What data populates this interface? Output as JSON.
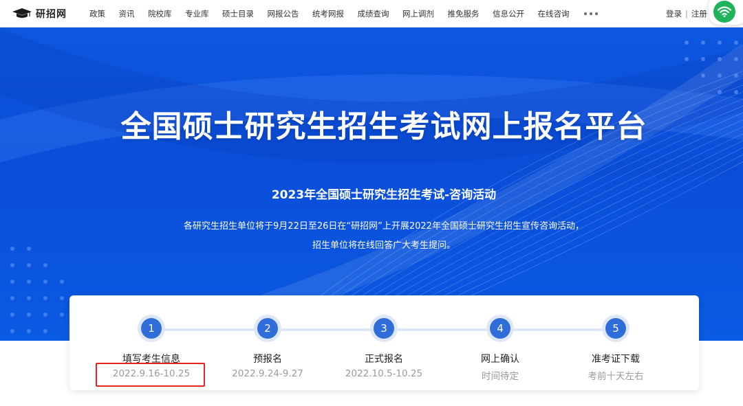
{
  "logo": {
    "text": "研招网",
    "icon": "graduation-cap-icon"
  },
  "nav": {
    "items": [
      "政策",
      "资讯",
      "院校库",
      "专业库",
      "硕士目录",
      "网报公告",
      "统考网报",
      "成绩查询",
      "网上调剂",
      "推免服务",
      "信息公开",
      "在线咨询"
    ],
    "more_icon": "more-dots-icon"
  },
  "auth": {
    "login": "登录",
    "separator": "|",
    "register": "注册"
  },
  "status_badge": {
    "icon": "wifi-icon",
    "color": "#20b45a"
  },
  "hero": {
    "title": "全国硕士研究生招生考试网上报名平台",
    "subtitle": "2023年全国硕士研究生招生考试-咨询活动",
    "desc_line1": "各研究生招生单位将于9月22日至26日在“研招网”上开展2022年全国硕士研究生招生宣传咨询活动，",
    "desc_line2": "招生单位将在线回答广大考生提问。"
  },
  "steps": [
    {
      "number": "1",
      "title": "填写考生信息",
      "date": "2022.9.16-10.25"
    },
    {
      "number": "2",
      "title": "预报名",
      "date": "2022.9.24-9.27"
    },
    {
      "number": "3",
      "title": "正式报名",
      "date": "2022.10.5-10.25"
    },
    {
      "number": "4",
      "title": "网上确认",
      "date": "时间待定"
    },
    {
      "number": "5",
      "title": "准考证下载",
      "date": "考前十天左右"
    }
  ],
  "colors": {
    "hero_blue": "#0b55e0",
    "step_blue": "#2f6dd9",
    "highlight_red": "#e8241f"
  }
}
